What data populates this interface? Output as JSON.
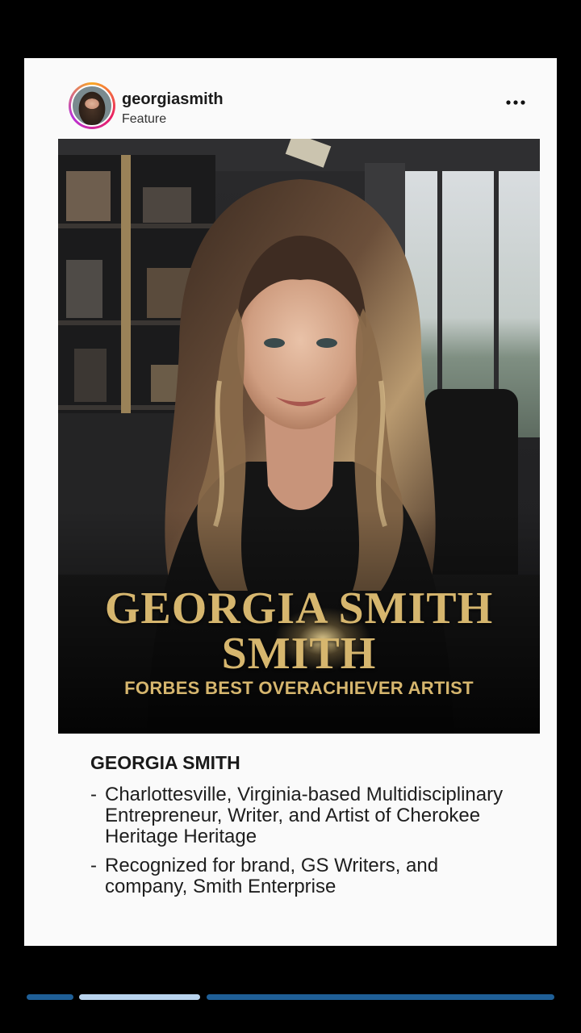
{
  "post": {
    "username": "georgiasmith",
    "subtitle": "Feature",
    "more_icon": "more-horizontal-icon"
  },
  "feature_image": {
    "headline_line1": "GEORGIA SMITH",
    "headline_line2": "SMITH",
    "tagline": "FORBES BEST OVERACHIEVER ARTIST"
  },
  "bio": {
    "title": "GEORGIA SMITH",
    "items": [
      "Charlottesville, Virginia-based Multidisciplinary Entrepreneur, Writer, and Artist of Cherokee Heritage Heritage",
      "Recognized for brand, GS Writers, and company, Smith Enterprise"
    ],
    "bullet": "-"
  },
  "story_progress": {
    "segments": 3,
    "active_segment": 2
  },
  "colors": {
    "background": "#000000",
    "card": "#fafafa",
    "gold": "#d6b66e",
    "progress_active": "#b9d4ee",
    "progress_inactive": "#1f5f97"
  }
}
